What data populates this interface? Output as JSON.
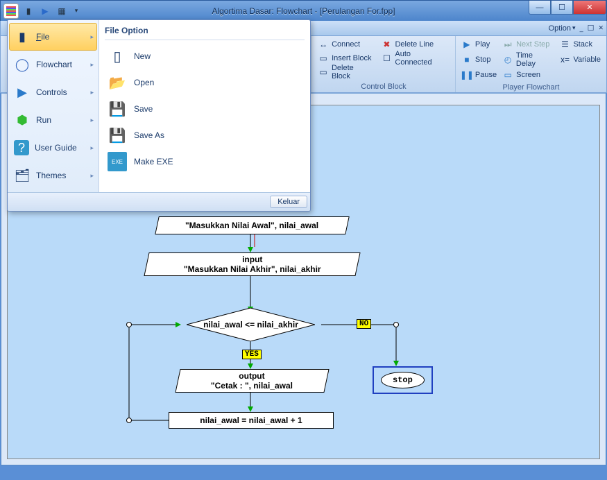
{
  "window": {
    "title": "Algortima Dasar: Flowchart - [Perulangan For.fpp]"
  },
  "ribbon_strip": {
    "option_label": "Option"
  },
  "ribbon": {
    "control_block": {
      "label": "Control Block",
      "items": {
        "connect": "Connect",
        "insert": "Insert Block",
        "delete_block": "Delete Block",
        "delete_line": "Delete Line",
        "auto_connected": "Auto Connected"
      }
    },
    "player": {
      "label": "Player Flowchart",
      "items": {
        "play": "Play",
        "stop": "Stop",
        "pause": "Pause",
        "next_step": "Next Step",
        "time_delay": "Time Delay",
        "screen": "Screen",
        "stack": "Stack",
        "variable": "Variable"
      }
    }
  },
  "app_menu": {
    "left": [
      {
        "label": "File",
        "underline": "F"
      },
      {
        "label": "Flowchart"
      },
      {
        "label": "Controls"
      },
      {
        "label": "Run"
      },
      {
        "label": "User Guide"
      },
      {
        "label": "Themes"
      }
    ],
    "header": "File Option",
    "options": [
      {
        "label": "New"
      },
      {
        "label": "Open"
      },
      {
        "label": "Save"
      },
      {
        "label": "Save As"
      },
      {
        "label": "Make EXE"
      }
    ],
    "exit": "Keluar"
  },
  "flowchart": {
    "io1": "\"Masukkan Nilai Awal\", nilai_awal",
    "io2_l1": "input",
    "io2_l2": "\"Masukkan Nilai Akhir\", nilai_akhir",
    "cond": "nilai_awal <= nilai_akhir",
    "yes": "YES",
    "no": "NO",
    "out_l1": "output",
    "out_l2": "\"Cetak : \", nilai_awal",
    "assign": "nilai_awal = nilai_awal + 1",
    "stop": "stop"
  }
}
